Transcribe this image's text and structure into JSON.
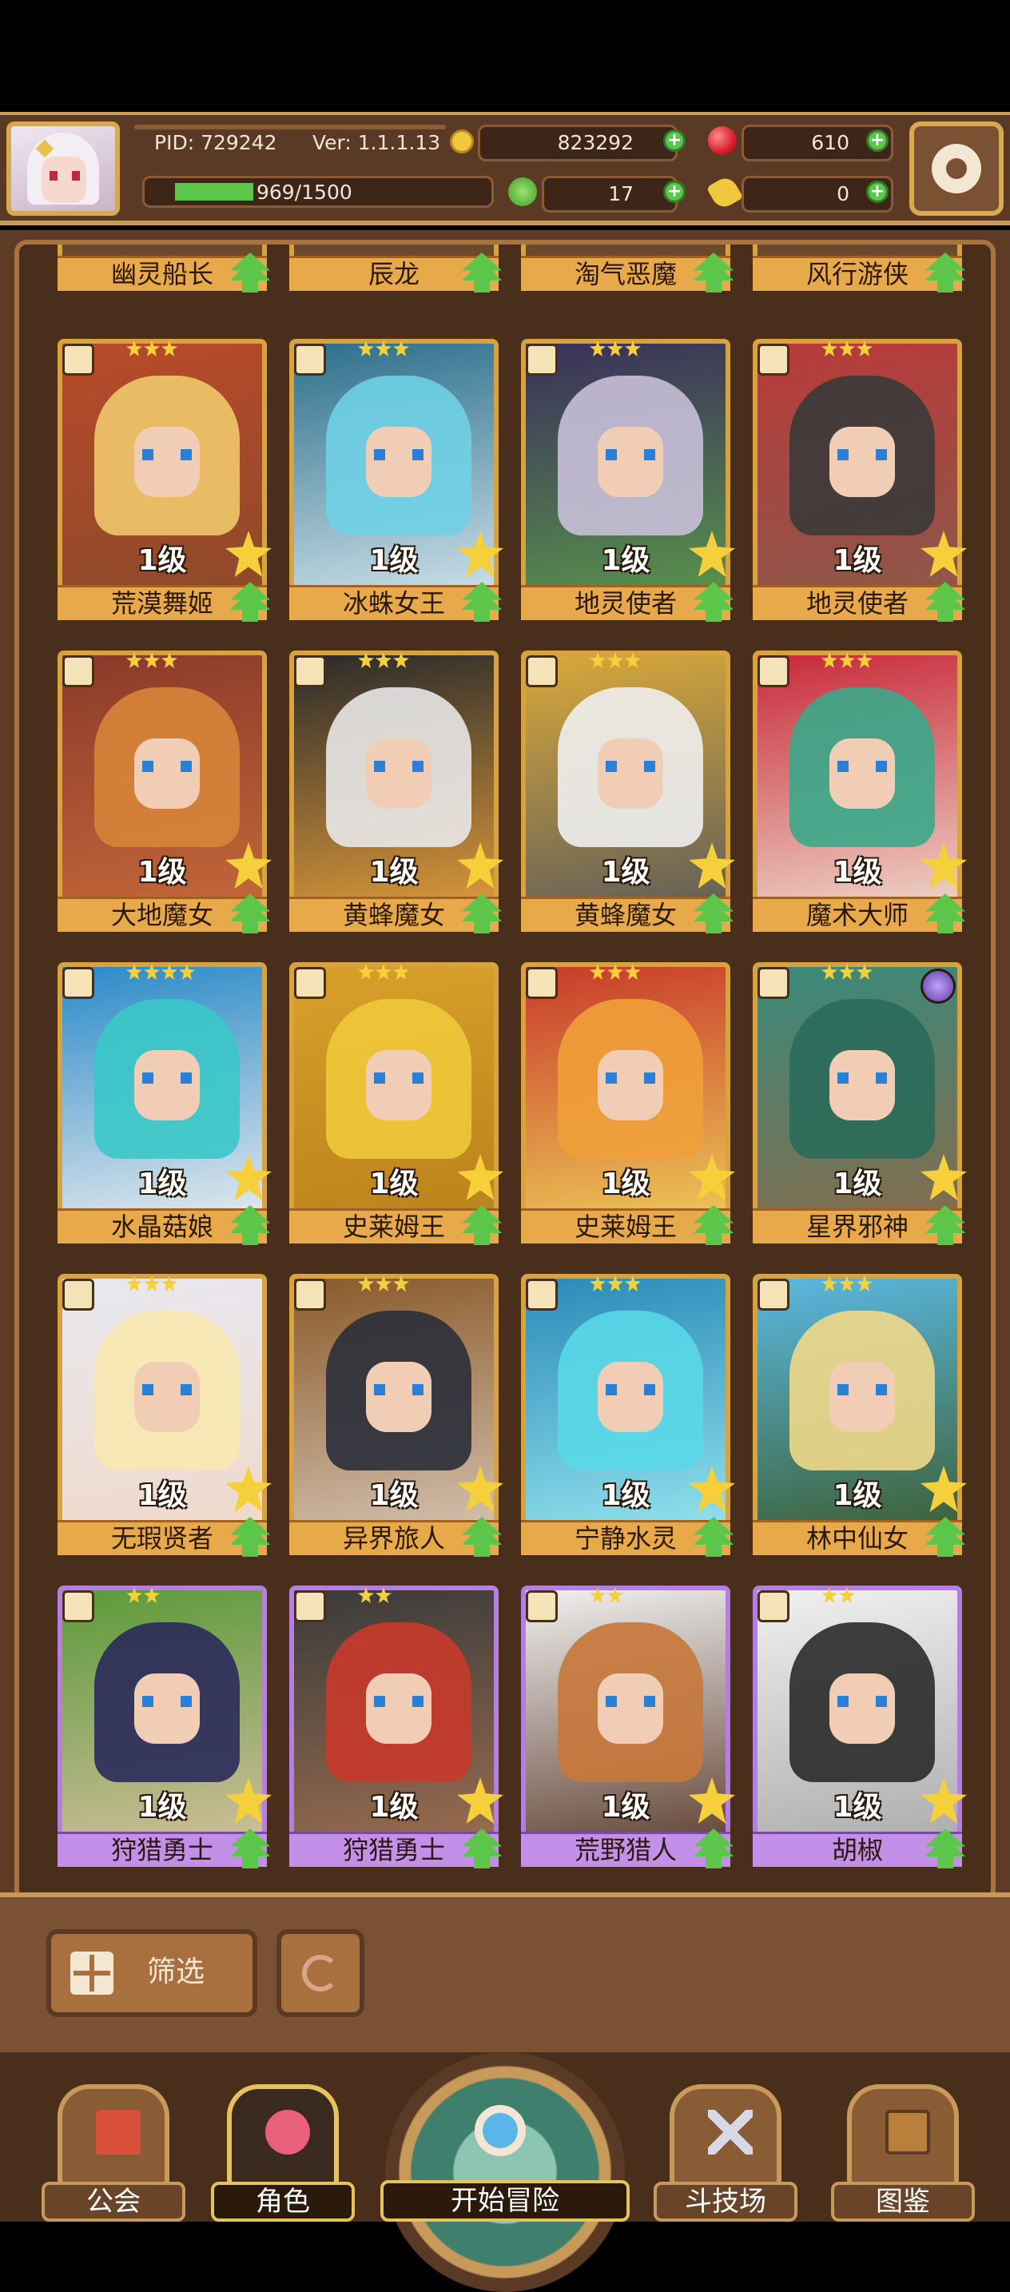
{
  "hud": {
    "pid": "PID: 729242",
    "version": "Ver: 1.1.1.13",
    "gold": "823292",
    "gems": "610",
    "xp": "969/1500",
    "xp_progress": 0.646,
    "clovers": "17",
    "keys": "0"
  },
  "colors": {
    "gold_frame": "#d8a23e",
    "purple_frame": "#b67ee0",
    "green_up": "#5cc64a",
    "star": "#f5d03a"
  },
  "heroes_top_row": [
    "幽灵船长",
    "辰龙",
    "淘气恶魔",
    "风行游侠"
  ],
  "heroes": [
    {
      "name": "荒漠舞姬",
      "level": "1级",
      "stars": 3,
      "rarity": "gold",
      "palette": [
        "#f0c86a",
        "#b84a2a",
        "#8a4a2a"
      ]
    },
    {
      "name": "冰蛛女王",
      "level": "1级",
      "stars": 3,
      "rarity": "gold",
      "palette": [
        "#6fd0e6",
        "#2c6f8a",
        "#d8e8f0"
      ]
    },
    {
      "name": "地灵使者",
      "level": "1级",
      "stars": 3,
      "rarity": "gold",
      "palette": [
        "#c8c0d8",
        "#3a2f5a",
        "#5a9a4a"
      ]
    },
    {
      "name": "地灵使者",
      "level": "1级",
      "stars": 3,
      "rarity": "gold",
      "palette": [
        "#3a3a3a",
        "#b83a3a",
        "#8a5a4a"
      ]
    },
    {
      "name": "大地魔女",
      "level": "1级",
      "stars": 3,
      "rarity": "gold",
      "palette": [
        "#d8843a",
        "#8a3a2a",
        "#c86a3a"
      ]
    },
    {
      "name": "黄蜂魔女",
      "level": "1级",
      "stars": 3,
      "rarity": "gold",
      "palette": [
        "#e8e8e8",
        "#2a2a2a",
        "#e8a03a"
      ]
    },
    {
      "name": "黄蜂魔女",
      "level": "1级",
      "stars": 3,
      "rarity": "gold",
      "palette": [
        "#f0f0f0",
        "#d8a83a",
        "#5a5a5a"
      ]
    },
    {
      "name": "魔术大师",
      "level": "1级",
      "stars": 3,
      "rarity": "gold",
      "palette": [
        "#3aa88a",
        "#c82a3a",
        "#f0e0d0"
      ]
    },
    {
      "name": "水晶菇娘",
      "level": "1级",
      "stars": 4,
      "rarity": "gold",
      "palette": [
        "#3ac8c8",
        "#2a8ac8",
        "#f0f0f0"
      ]
    },
    {
      "name": "史莱姆王",
      "level": "1级",
      "stars": 3,
      "rarity": "gold",
      "palette": [
        "#f0c83a",
        "#d8a02a",
        "#b8801a"
      ]
    },
    {
      "name": "史莱姆王",
      "level": "1级",
      "stars": 3,
      "rarity": "gold",
      "palette": [
        "#f0a03a",
        "#c83a2a",
        "#f0d05a"
      ]
    },
    {
      "name": "星界邪神",
      "level": "1级",
      "stars": 3,
      "rarity": "gold",
      "palette": [
        "#2a6a5a",
        "#3a8a7a",
        "#8a6a4a"
      ],
      "badge": true
    },
    {
      "name": "无瑕贤者",
      "level": "1级",
      "stars": 3,
      "rarity": "gold",
      "palette": [
        "#f8e8b0",
        "#e8e8f0",
        "#f0d8c8"
      ]
    },
    {
      "name": "异界旅人",
      "level": "1级",
      "stars": 3,
      "rarity": "gold",
      "palette": [
        "#2a2f3a",
        "#8a5a2a",
        "#d8c8b8"
      ]
    },
    {
      "name": "宁静水灵",
      "level": "1级",
      "stars": 3,
      "rarity": "gold",
      "palette": [
        "#5ad8e8",
        "#2a8ab8",
        "#9ae8f0"
      ]
    },
    {
      "name": "林中仙女",
      "level": "1级",
      "stars": 3,
      "rarity": "gold",
      "palette": [
        "#f0d88a",
        "#5ab8e0",
        "#3a5a2a"
      ]
    },
    {
      "name": "狩猎勇士",
      "level": "1级",
      "stars": 2,
      "rarity": "purple",
      "palette": [
        "#2a2a5a",
        "#5a9a3a",
        "#d8c0a0"
      ]
    },
    {
      "name": "狩猎勇士",
      "level": "1级",
      "stars": 2,
      "rarity": "purple",
      "palette": [
        "#c83a2a",
        "#3a3a3a",
        "#a07050"
      ]
    },
    {
      "name": "荒野猎人",
      "level": "1级",
      "stars": 2,
      "rarity": "purple",
      "palette": [
        "#c8783a",
        "#f0f0f0",
        "#5a3a2a"
      ]
    },
    {
      "name": "胡椒",
      "level": "1级",
      "stars": 2,
      "rarity": "purple",
      "palette": [
        "#2a2a2a",
        "#f0f0f0",
        "#a8a8a8"
      ]
    }
  ],
  "filter": {
    "label": "筛选"
  },
  "nav": {
    "guild": "公会",
    "characters": "角色",
    "adventure": "开始冒险",
    "arena": "斗技场",
    "codex": "图鉴"
  }
}
